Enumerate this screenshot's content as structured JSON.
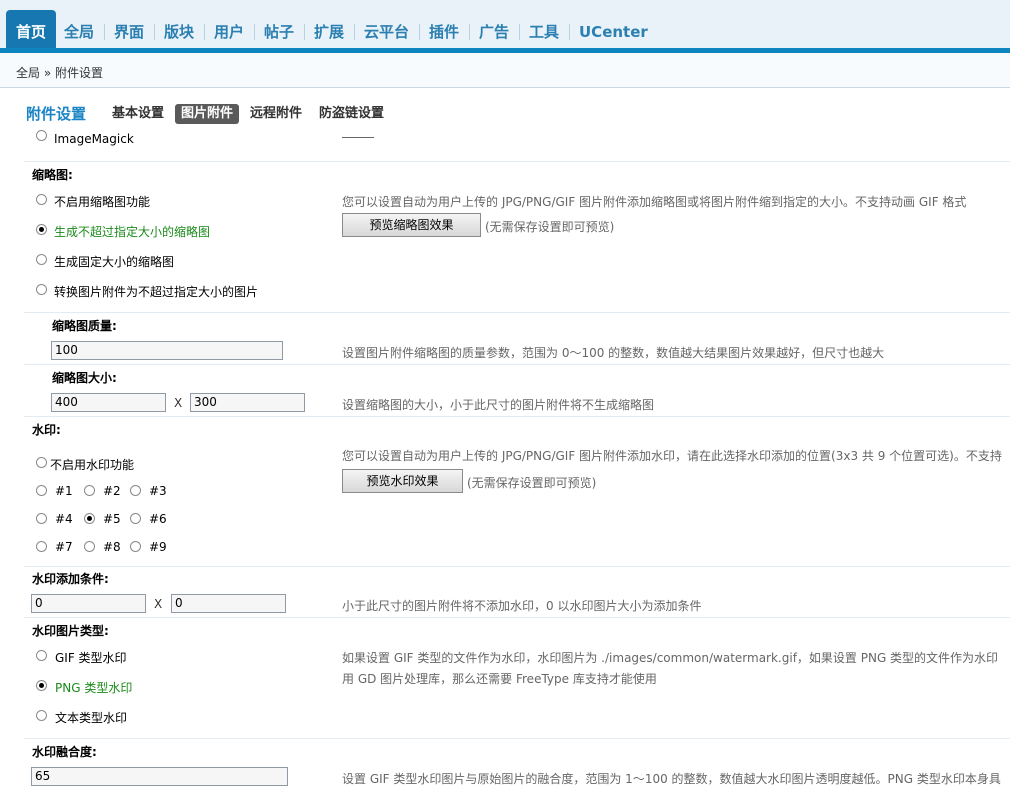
{
  "topnav": {
    "tabs": [
      "首页",
      "全局",
      "界面",
      "版块",
      "用户",
      "帖子",
      "扩展",
      "云平台",
      "插件",
      "广告",
      "工具",
      "UCenter"
    ]
  },
  "breadcrumb": "全局 » 附件设置",
  "subnav": {
    "title": "附件设置",
    "tabs": [
      "基本设置",
      "图片附件",
      "远程附件",
      "防盗链设置"
    ],
    "active": "图片附件"
  },
  "imagemagick_option": "ImageMagick",
  "thumb": {
    "label": "缩略图:",
    "options": [
      "不启用缩略图功能",
      "生成不超过指定大小的缩略图",
      "生成固定大小的缩略图",
      "转换图片附件为不超过指定大小的图片"
    ],
    "selected": 1,
    "desc": "您可以设置自动为用户上传的 JPG/PNG/GIF 图片附件添加缩略图或将图片附件缩到指定的大小。不支持动画 GIF 格式",
    "preview_button": "预览缩略图效果",
    "preview_note": "(无需保存设置即可预览)"
  },
  "thumb_quality": {
    "label": "缩略图质量:",
    "value": "100",
    "desc": "设置图片附件缩略图的质量参数，范围为 0～100 的整数，数值越大结果图片效果越好，但尺寸也越大"
  },
  "thumb_size": {
    "label": "缩略图大小:",
    "width": "400",
    "height": "300",
    "separator": "X",
    "desc": "设置缩略图的大小，小于此尺寸的图片附件将不生成缩略图"
  },
  "watermark": {
    "label": "水印:",
    "off_label": "不启用水印功能",
    "positions": [
      "#1",
      "#2",
      "#3",
      "#4",
      "#5",
      "#6",
      "#7",
      "#8",
      "#9"
    ],
    "selected": "#5",
    "desc": "您可以设置自动为用户上传的 JPG/PNG/GIF 图片附件添加水印，请在此选择水印添加的位置(3x3 共 9 个位置可选)。不支持",
    "preview_button": "预览水印效果",
    "preview_note": "(无需保存设置即可预览)"
  },
  "watermark_condition": {
    "label": "水印添加条件:",
    "width": "0",
    "height": "0",
    "separator": "X",
    "desc": "小于此尺寸的图片附件将不添加水印，0 以水印图片大小为添加条件"
  },
  "watermark_type": {
    "label": "水印图片类型:",
    "options": [
      "GIF 类型水印",
      "PNG 类型水印",
      "文本类型水印"
    ],
    "selected": 1,
    "desc_line1": "如果设置 GIF 类型的文件作为水印，水印图片为 ./images/common/watermark.gif，如果设置 PNG 类型的文件作为水印",
    "desc_line2": "用 GD 图片处理库，那么还需要 FreeType 库支持才能使用"
  },
  "watermark_blend": {
    "label": "水印融合度:",
    "value": "65",
    "desc": "设置 GIF 类型水印图片与原始图片的融合度，范围为 1～100 的整数，数值越大水印图片透明度越低。PNG 类型水印本身具"
  }
}
